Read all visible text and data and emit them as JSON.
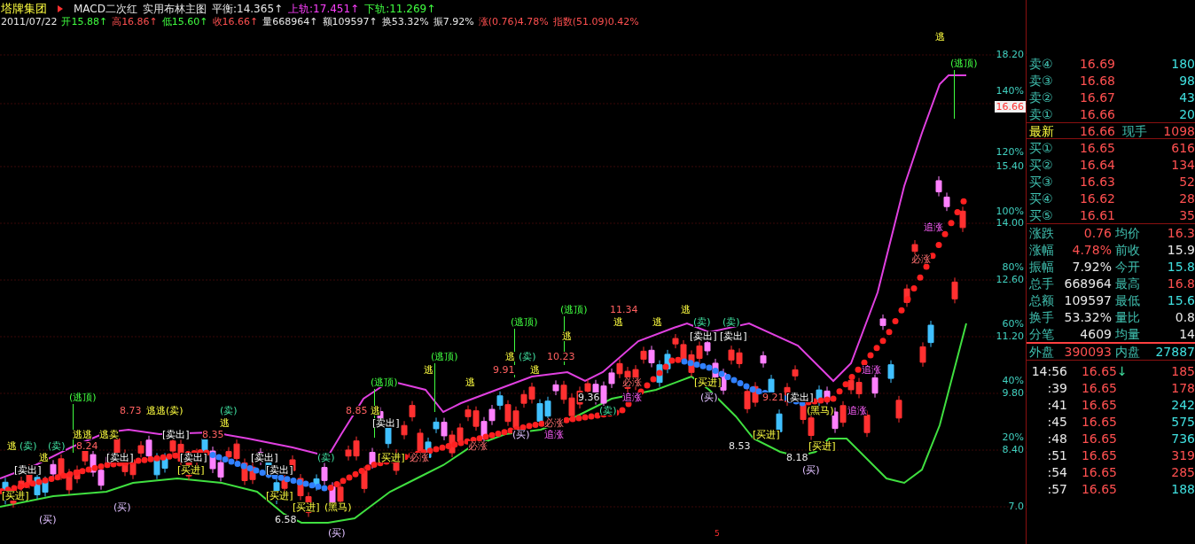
{
  "header": {
    "stock": "塔牌集团",
    "indicator": "MACD二次红",
    "study": "实用布林主图",
    "lines": [
      {
        "text": "平衡:14.365↑",
        "color": "#e8e8e8"
      },
      {
        "text": "上轨:17.451↑",
        "color": "#ff40ff"
      },
      {
        "text": "下轨:11.269↑",
        "color": "#40ff40"
      }
    ]
  },
  "quote_bar": {
    "date": "2011/07/22",
    "items": [
      {
        "text": "开15.88↑",
        "color": "#40ff40"
      },
      {
        "text": "高16.86↑",
        "color": "#ff5050"
      },
      {
        "text": "低15.60↑",
        "color": "#40ff40"
      },
      {
        "text": "收16.66↑",
        "color": "#ff5050"
      },
      {
        "text": "量668964↑",
        "color": "#e8e8e8"
      },
      {
        "text": "额109597↑",
        "color": "#e8e8e8"
      },
      {
        "text": "换53.32%",
        "color": "#e8e8e8"
      },
      {
        "text": "振7.92%",
        "color": "#e8e8e8"
      },
      {
        "text": "涨(0.76)4.78%",
        "color": "#ff5050"
      },
      {
        "text": "指数(51.09)0.42%",
        "color": "#ff5050"
      }
    ]
  },
  "chart": {
    "price_marker": "16.66",
    "bottom_marker": "5",
    "y_axis": [
      {
        "text": "18.20"
      },
      {
        "text": "140%"
      },
      {
        "text": "120%"
      },
      {
        "text": "15.40"
      },
      {
        "text": "100%"
      },
      {
        "text": "14.00"
      },
      {
        "text": "80%"
      },
      {
        "text": "12.60"
      },
      {
        "text": "60%"
      },
      {
        "text": "11.20"
      },
      {
        "text": "40%"
      },
      {
        "text": "9.80"
      },
      {
        "text": "20%"
      },
      {
        "text": "8.40"
      },
      {
        "text": "7.0"
      }
    ],
    "signals": [
      {
        "text": "逃",
        "kind": "escape"
      },
      {
        "text": "(逃顶)",
        "kind": "escape_top"
      },
      {
        "text": "追涨",
        "kind": "chase"
      },
      {
        "text": "必涨",
        "kind": "must_rise"
      },
      {
        "text": "(逃顶)",
        "kind": "escape_top"
      },
      {
        "text": "11.34",
        "kind": "price"
      },
      {
        "text": "逃",
        "kind": "escape"
      },
      {
        "text": "(逃顶)",
        "kind": "escape_top"
      },
      {
        "text": "逃",
        "kind": "escape"
      },
      {
        "text": "逃",
        "kind": "escape"
      },
      {
        "text": "(卖)",
        "kind": "sell_circle"
      },
      {
        "text": "(卖)",
        "kind": "sell_circle"
      },
      {
        "text": "逃",
        "kind": "escape"
      },
      {
        "text": "[卖出]",
        "kind": "sell"
      },
      {
        "text": "[卖出]",
        "kind": "sell"
      },
      {
        "text": "(逃顶)",
        "kind": "escape_top"
      },
      {
        "text": "逃",
        "kind": "escape"
      },
      {
        "text": "(卖)",
        "kind": "sell_circle"
      },
      {
        "text": "10.23",
        "kind": "price"
      },
      {
        "text": "逃",
        "kind": "escape"
      },
      {
        "text": "9.91",
        "kind": "price"
      },
      {
        "text": "逃",
        "kind": "escape"
      },
      {
        "text": "追涨",
        "kind": "chase"
      },
      {
        "text": "(逃顶)",
        "kind": "escape_top"
      },
      {
        "text": "逃",
        "kind": "escape"
      },
      {
        "text": "必涨",
        "kind": "must_rise"
      },
      {
        "text": "[买进]",
        "kind": "buy"
      },
      {
        "text": "(逃顶)",
        "kind": "escape_top"
      },
      {
        "text": "9.36",
        "kind": "price_low"
      },
      {
        "text": "追涨",
        "kind": "chase"
      },
      {
        "text": "(买)",
        "kind": "buy_circle"
      },
      {
        "text": "9.21",
        "kind": "price"
      },
      {
        "text": "[卖出]",
        "kind": "sell"
      },
      {
        "text": "8.73",
        "kind": "price"
      },
      {
        "text": "逃逃(卖)",
        "kind": "escape"
      },
      {
        "text": "(卖)",
        "kind": "sell_circle"
      },
      {
        "text": "8.85",
        "kind": "price"
      },
      {
        "text": "逃",
        "kind": "escape"
      },
      {
        "text": "(卖)",
        "kind": "sell_circle"
      },
      {
        "text": "(黑马)",
        "kind": "dark_horse"
      },
      {
        "text": "追涨",
        "kind": "chase"
      },
      {
        "text": "逃",
        "kind": "escape"
      },
      {
        "text": "[卖出]",
        "kind": "sell"
      },
      {
        "text": "必涨",
        "kind": "must_rise"
      },
      {
        "text": "逃逃",
        "kind": "escape"
      },
      {
        "text": "逃卖",
        "kind": "escape"
      },
      {
        "text": "[卖出]",
        "kind": "sell"
      },
      {
        "text": "8.35",
        "kind": "price"
      },
      {
        "text": "(买)",
        "kind": "buy_circle"
      },
      {
        "text": "追涨",
        "kind": "chase"
      },
      {
        "text": "[买进]",
        "kind": "buy"
      },
      {
        "text": "逃",
        "kind": "escape"
      },
      {
        "text": "(卖)",
        "kind": "sell_circle"
      },
      {
        "text": "(卖)",
        "kind": "sell_circle"
      },
      {
        "text": "8.24",
        "kind": "price"
      },
      {
        "text": "必涨",
        "kind": "must_rise"
      },
      {
        "text": "8.53",
        "kind": "price_low"
      },
      {
        "text": "[买进]",
        "kind": "buy"
      },
      {
        "text": "逃",
        "kind": "escape"
      },
      {
        "text": "[卖出]",
        "kind": "sell"
      },
      {
        "text": "[卖出]",
        "kind": "sell"
      },
      {
        "text": "[卖出]",
        "kind": "sell"
      },
      {
        "text": "(卖)",
        "kind": "sell_circle"
      },
      {
        "text": "[买进]",
        "kind": "buy"
      },
      {
        "text": "必涨",
        "kind": "must_rise"
      },
      {
        "text": "8.18",
        "kind": "price_low"
      },
      {
        "text": "[卖出]",
        "kind": "sell"
      },
      {
        "text": "[买进]",
        "kind": "buy"
      },
      {
        "text": "[卖出]",
        "kind": "sell"
      },
      {
        "text": "(买)",
        "kind": "buy_circle"
      },
      {
        "text": "[买进]",
        "kind": "buy"
      },
      {
        "text": "[买进]",
        "kind": "buy"
      },
      {
        "text": "(买)",
        "kind": "buy_circle"
      },
      {
        "text": "[买进]",
        "kind": "buy"
      },
      {
        "text": "(黑马)",
        "kind": "dark_horse"
      },
      {
        "text": "(买)",
        "kind": "buy_circle"
      },
      {
        "text": "6.58",
        "kind": "price_low"
      },
      {
        "text": "(买)",
        "kind": "buy_circle"
      }
    ]
  },
  "order_book": {
    "asks": [
      {
        "label": "卖④",
        "price": "16.69",
        "volume": "180"
      },
      {
        "label": "卖③",
        "price": "16.68",
        "volume": "98"
      },
      {
        "label": "卖②",
        "price": "16.67",
        "volume": "43"
      },
      {
        "label": "卖①",
        "price": "16.66",
        "volume": "20"
      }
    ],
    "latest": {
      "label": "最新",
      "price": "16.66",
      "volume_label": "现手",
      "volume": "1098"
    },
    "bids": [
      {
        "label": "买①",
        "price": "16.65",
        "volume": "616"
      },
      {
        "label": "买②",
        "price": "16.64",
        "volume": "134"
      },
      {
        "label": "买③",
        "price": "16.63",
        "volume": "52"
      },
      {
        "label": "买④",
        "price": "16.62",
        "volume": "28"
      },
      {
        "label": "买⑤",
        "price": "16.61",
        "volume": "35"
      }
    ]
  },
  "stats": [
    {
      "left": {
        "label": "涨跌",
        "value": "0.76",
        "color": "#ff5050"
      },
      "right": {
        "label": "均价",
        "value": "16.3",
        "color": "#ff5050"
      }
    },
    {
      "left": {
        "label": "涨幅",
        "value": "4.78%",
        "color": "#ff5050"
      },
      "right": {
        "label": "前收",
        "value": "15.9",
        "color": "#e8e8e8"
      }
    },
    {
      "left": {
        "label": "振幅",
        "value": "7.92%",
        "color": "#e8e8e8"
      },
      "right": {
        "label": "今开",
        "value": "15.8",
        "color": "#40e0e0"
      }
    },
    {
      "left": {
        "label": "总手",
        "value": "668964",
        "color": "#e8e8e8"
      },
      "right": {
        "label": "最高",
        "value": "16.8",
        "color": "#ff5050"
      }
    },
    {
      "left": {
        "label": "总额",
        "value": "109597",
        "color": "#e8e8e8"
      },
      "right": {
        "label": "最低",
        "value": "15.6",
        "color": "#40e0e0"
      }
    },
    {
      "left": {
        "label": "换手",
        "value": "53.32%",
        "color": "#e8e8e8"
      },
      "right": {
        "label": "量比",
        "value": "0.8",
        "color": "#e8e8e8"
      }
    },
    {
      "left": {
        "label": "分笔",
        "value": "4609",
        "color": "#e8e8e8"
      },
      "right": {
        "label": "均量",
        "value": "14",
        "color": "#e8e8e8"
      }
    }
  ],
  "outer_inner": {
    "outer_label": "外盘",
    "outer": "390093",
    "inner_label": "内盘",
    "inner": "27887"
  },
  "ticks": [
    {
      "time": "14:56",
      "price": "16.65",
      "arrow": "↓",
      "volume": "185",
      "color": "#ff5050"
    },
    {
      "time": ":39",
      "price": "16.65",
      "volume": "178",
      "color": "#ff5050"
    },
    {
      "time": ":41",
      "price": "16.65",
      "volume": "242",
      "color": "#40e0e0"
    },
    {
      "time": ":45",
      "price": "16.65",
      "volume": "575",
      "color": "#40e0e0"
    },
    {
      "time": ":48",
      "price": "16.65",
      "volume": "736",
      "color": "#40e0e0"
    },
    {
      "time": ":51",
      "price": "16.65",
      "volume": "319",
      "color": "#ff5050"
    },
    {
      "time": ":54",
      "price": "16.65",
      "volume": "285",
      "color": "#ff5050"
    },
    {
      "time": ":57",
      "price": "16.65",
      "volume": "188",
      "color": "#40e0e0"
    }
  ]
}
